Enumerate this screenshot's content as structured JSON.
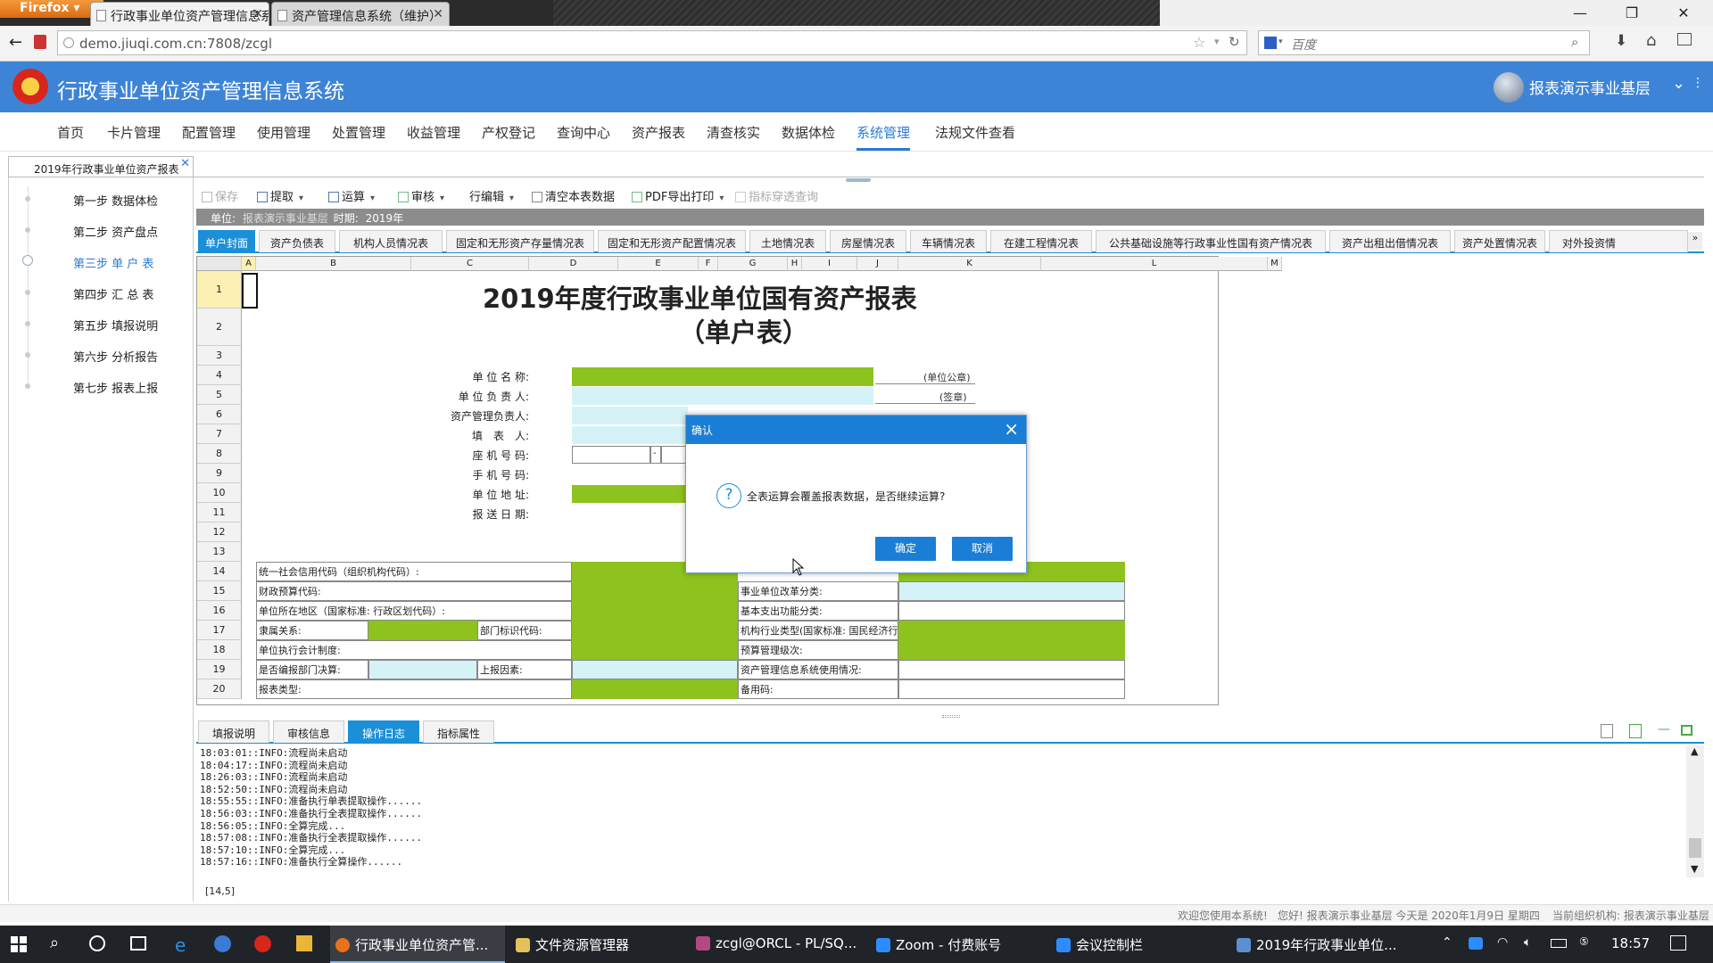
{
  "browser": {
    "app_button": "Firefox",
    "tabs": [
      {
        "title": "行政事业单位资产管理信息系..."
      },
      {
        "title": "资产管理信息系统（维护）"
      }
    ],
    "url": "demo.jiuqi.com.cn:7808/zcgl",
    "search_placeholder": "百度"
  },
  "app": {
    "title": "行政事业单位资产管理信息系统",
    "user": "报表演示事业基层"
  },
  "menu": [
    {
      "label": "首页"
    },
    {
      "label": "卡片管理"
    },
    {
      "label": "配置管理"
    },
    {
      "label": "使用管理"
    },
    {
      "label": "处置管理"
    },
    {
      "label": "收益管理"
    },
    {
      "label": "产权登记"
    },
    {
      "label": "查询中心"
    },
    {
      "label": "资产报表"
    },
    {
      "label": "清查核实"
    },
    {
      "label": "数据体检"
    },
    {
      "label": "系统管理"
    },
    {
      "label": "法规文件查看"
    }
  ],
  "doc_tab": "2019年行政事业单位资产报表",
  "steps": [
    {
      "label": "第一步  数据体检"
    },
    {
      "label": "第二步  资产盘点"
    },
    {
      "label": "第三步  单 户 表"
    },
    {
      "label": "第四步  汇 总 表"
    },
    {
      "label": "第五步  填报说明"
    },
    {
      "label": "第六步  分析报告"
    },
    {
      "label": "第七步  报表上报"
    }
  ],
  "toolbar": {
    "save": "保存",
    "extract": "提取",
    "calc": "运算",
    "audit": "审核",
    "row_edit": "行编辑",
    "clear": "清空本表数据",
    "pdf": "PDF导出打印",
    "drill": "指标穿透查询"
  },
  "unit_bar": {
    "unit_label": "单位:",
    "unit_value": "报表演示事业基层",
    "period_label": "时期:",
    "period_value": "2019年"
  },
  "sheet_tabs": [
    {
      "label": "单户封面"
    },
    {
      "label": "资产负债表"
    },
    {
      "label": "机构人员情况表"
    },
    {
      "label": "固定和无形资产存量情况表"
    },
    {
      "label": "固定和无形资产配置情况表"
    },
    {
      "label": "土地情况表"
    },
    {
      "label": "房屋情况表"
    },
    {
      "label": "车辆情况表"
    },
    {
      "label": "在建工程情况表"
    },
    {
      "label": "公共基础设施等行政事业性国有资产情况表"
    },
    {
      "label": "资产出租出借情况表"
    },
    {
      "label": "资产处置情况表"
    },
    {
      "label": "对外投资情"
    }
  ],
  "grid": {
    "columns": [
      "A",
      "B",
      "C",
      "D",
      "E",
      "F",
      "G",
      "H",
      "I",
      "J",
      "K",
      "L",
      "M"
    ],
    "rows": [
      "1",
      "2",
      "3",
      "4",
      "5",
      "6",
      "7",
      "8",
      "9",
      "10",
      "11",
      "12",
      "13",
      "14",
      "15",
      "16",
      "17",
      "18",
      "19",
      "20"
    ],
    "title1": "2019年度行政事业单位国有资产报表",
    "title2": "（单户表）",
    "fields": {
      "unit_name": "单 位 名 称:",
      "unit_head": "单 位 负 责 人:",
      "asset_head": "资产管理负责人:",
      "filler": "填　表　人:",
      "landline": "座 机 号 码:",
      "mobile": "手 机 号 码:",
      "address": "单 位 地 址:",
      "send_date": "报 送 日 期:"
    },
    "notes": {
      "seal": "(单位公章)",
      "sign": "(签章)",
      "dash": "-"
    },
    "table": {
      "credit_code": "统一社会信用代码（组织机构代码）:",
      "budget_code": "财政预算代码:",
      "region": "单位所在地区（国家标准: 行政区划代码）:",
      "affiliation": "隶属关系:",
      "dept_code": "部门标识代码:",
      "accounting": "单位执行会计制度:",
      "final_budget": "是否编报部门决算:",
      "report_factor": "上报因素:",
      "report_type": "报表类型:",
      "unit_class": "事业单位改革分类:",
      "expense_func": "基本支出功能分类:",
      "industry": "机构行业类型(国家标准: 国民经济行业分类):",
      "budget_level": "预算管理级次:",
      "system_usage": "资产管理信息系统使用情况:",
      "backup_code": "备用码:"
    }
  },
  "bottom_tabs": [
    {
      "label": "填报说明"
    },
    {
      "label": "审核信息"
    },
    {
      "label": "操作日志"
    },
    {
      "label": "指标属性"
    }
  ],
  "log_lines": [
    "18:03:01::INFO:流程尚未启动",
    "18:04:17::INFO:流程尚未启动",
    "18:26:03::INFO:流程尚未启动",
    "18:52:50::INFO:流程尚未启动",
    "18:55:55::INFO:准备执行单表提取操作......",
    "18:56:03::INFO:准备执行全表提取操作......",
    "18:56:05::INFO:全算完成...",
    "18:57:08::INFO:准备执行全表提取操作......",
    "18:57:10::INFO:全算完成...",
    "18:57:16::INFO:准备执行全算操作......"
  ],
  "cell_coord": "[14,5]",
  "status": {
    "welcome": "欢迎您使用本系统!",
    "greeting": "您好! 报表演示事业基层 今天是 2020年1月9日 星期四",
    "org": "当前组织机构: 报表演示事业基层"
  },
  "dialog": {
    "title": "确认",
    "message": "全表运算会覆盖报表数据，是否继续运算?",
    "ok": "确定",
    "cancel": "取消"
  },
  "taskbar": {
    "items": [
      {
        "label": "行政事业单位资产管..."
      },
      {
        "label": "文件资源管理器"
      },
      {
        "label": "zcgl@ORCL - PL/SQ..."
      },
      {
        "label": "Zoom - 付费账号"
      },
      {
        "label": "会议控制栏"
      },
      {
        "label": "2019年行政事业单位..."
      }
    ],
    "clock": "18:57"
  },
  "colors": {
    "header_blue": "#3d84d6",
    "tab_blue": "#1b8fd8",
    "green_fill": "#8dc21f",
    "cyan_fill": "#d5f3f6"
  }
}
